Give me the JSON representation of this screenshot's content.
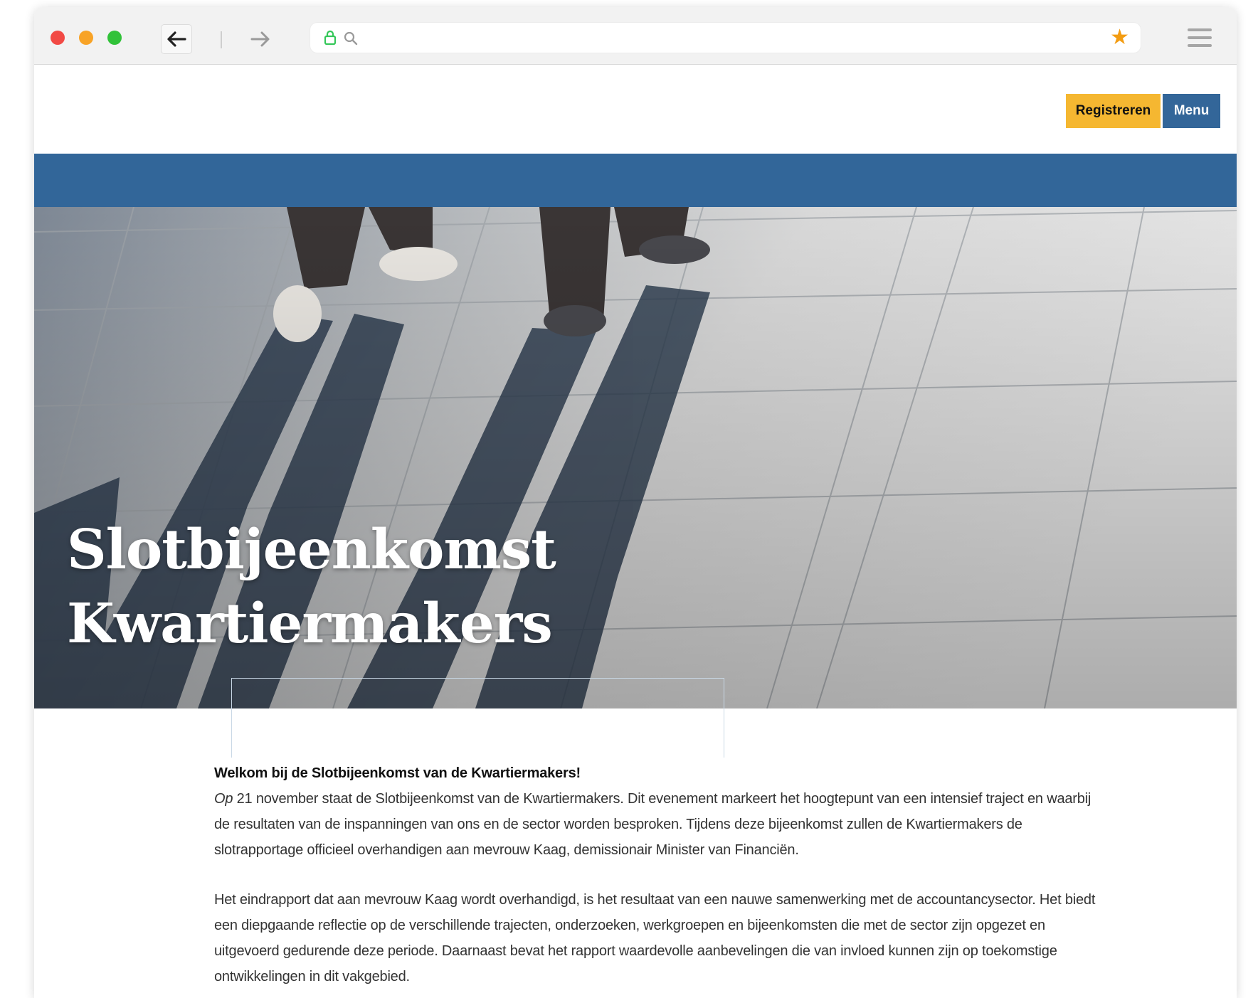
{
  "browser": {
    "url": "",
    "icons": {
      "back": "arrow-left-icon",
      "forward": "arrow-right-icon",
      "lock": "lock-icon",
      "search": "search-icon",
      "star": "star-icon",
      "menu": "hamburger-icon"
    },
    "colors": {
      "close": "#f24a45",
      "minimize": "#f8a326",
      "maximize": "#31c239",
      "star": "#f39c12",
      "lock": "#34c759"
    }
  },
  "header": {
    "register_label": "Registreren",
    "menu_label": "Menu",
    "colors": {
      "register_bg": "#f5b731",
      "menu_bg": "#336699",
      "band": "#326699"
    }
  },
  "hero": {
    "title_line1": "Slotbijeenkomst",
    "title_line2": "Kwartiermakers"
  },
  "content": {
    "lead": "Welkom bij de Slotbijeenkomst van de Kwartiermakers!",
    "p1_em": "Op",
    "p1_rest": " 21 november staat de Slotbijeenkomst van de Kwartiermakers. Dit evenement markeert het hoogtepunt van een intensief traject en waarbij de resultaten van de inspanningen van ons en de sector worden besproken. Tijdens deze bijeenkomst zullen de Kwartiermakers de slotrapportage officieel overhandigen aan mevrouw Kaag, demissionair Minister van Financiën.",
    "p2": "Het eindrapport dat aan mevrouw Kaag wordt overhandigd, is het resultaat van een nauwe samenwerking met de accountancysector. Het biedt een diepgaande reflectie op de verschillende trajecten, onderzoeken, werkgroepen en bijeenkomsten die met de sector zijn opgezet en uitgevoerd gedurende deze periode. Daarnaast bevat het rapport waardevolle aanbevelingen die van invloed kunnen zijn op toekomstige ontwikkelingen in dit vakgebied."
  }
}
